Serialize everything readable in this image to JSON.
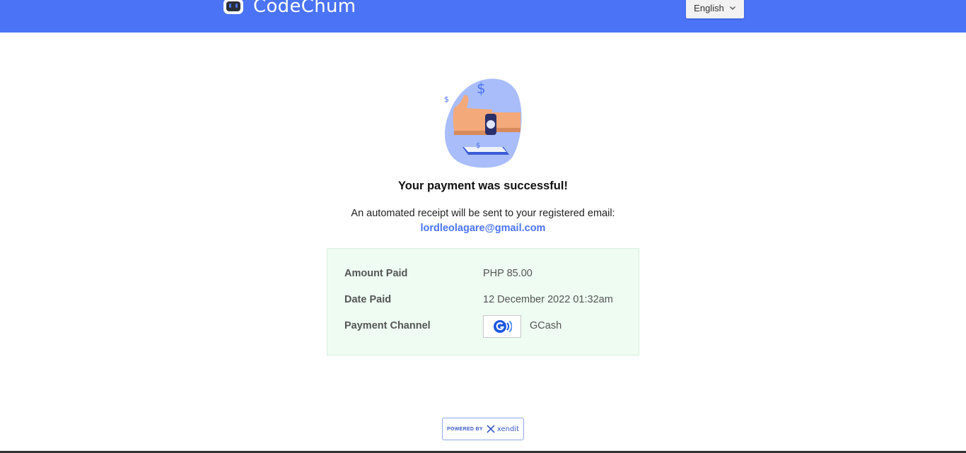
{
  "header": {
    "brand_name": "CodeChum",
    "language": "English"
  },
  "main": {
    "title": "Your payment was successful!",
    "receipt_message": "An automated receipt will be sent to your registered email:",
    "email": "lordleolagare@gmail.com"
  },
  "payment": {
    "amount_label": "Amount Paid",
    "amount_value": "PHP 85.00",
    "date_label": "Date Paid",
    "date_value": "12 December 2022 01:32am",
    "channel_label": "Payment Channel",
    "channel_value": "GCash",
    "channel_icon": "gcash-logo"
  },
  "footer": {
    "powered_by": "POWERED BY",
    "provider": "xendit"
  },
  "colors": {
    "header_bg": "#4a73f5",
    "accent": "#4a73f5",
    "card_bg": "#eefcf2"
  }
}
